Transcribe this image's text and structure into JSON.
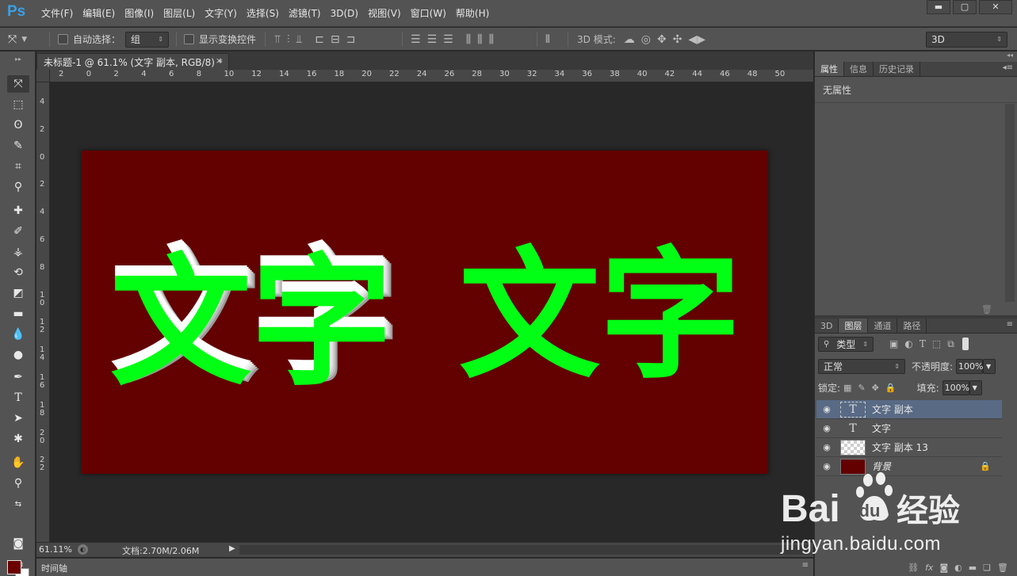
{
  "app": {
    "logo": "Ps",
    "menu": [
      "文件(F)",
      "编辑(E)",
      "图像(I)",
      "图层(L)",
      "文字(Y)",
      "选择(S)",
      "滤镜(T)",
      "3D(D)",
      "视图(V)",
      "窗口(W)",
      "帮助(H)"
    ],
    "window_controls": [
      "▬",
      "▢",
      "✕"
    ]
  },
  "options_bar": {
    "auto_select_label": "自动选择：",
    "auto_select_value": "组",
    "show_transform_label": "显示变换控件",
    "mode_label": "3D 模式:",
    "workspace_value": "3D"
  },
  "document": {
    "tab_title": "未标题-1 @ 61.1% (文字 副本, RGB/8) *",
    "tab_close": "×",
    "ruler_h": [
      "2",
      "0",
      "2",
      "4",
      "6",
      "8",
      "10",
      "12",
      "14",
      "16",
      "18",
      "20",
      "22",
      "24",
      "26",
      "28",
      "30",
      "32",
      "34",
      "36",
      "38",
      "40",
      "42",
      "44",
      "46",
      "48",
      "50"
    ],
    "ruler_v": [
      "4",
      "2",
      "0",
      "2",
      "4",
      "6",
      "8",
      "10",
      "12",
      "14",
      "16",
      "18",
      "20",
      "22"
    ],
    "canvas_color": "#630000",
    "text_left": "文字",
    "text_right": "文字",
    "text_color": "#00ff14"
  },
  "status": {
    "zoom": "61.11%",
    "doc_info": "文档:2.70M/2.06M",
    "timeline_label": "时间轴"
  },
  "properties_panel": {
    "tabs": [
      "属性",
      "信息",
      "历史记录"
    ],
    "content": "无属性"
  },
  "layers_panel": {
    "tabs": [
      "3D",
      "图层",
      "通道",
      "路径"
    ],
    "filter_label": "类型",
    "blend_mode": "正常",
    "opacity_label": "不透明度:",
    "opacity_value": "100%",
    "lock_label": "锁定:",
    "fill_label": "填充:",
    "fill_value": "100%",
    "layers": [
      {
        "name": "文字 副本",
        "type": "text",
        "selected": true
      },
      {
        "name": "文字",
        "type": "text",
        "selected": false
      },
      {
        "name": "文字 副本 13",
        "type": "raster",
        "selected": false
      },
      {
        "name": "背景",
        "type": "background",
        "selected": false
      }
    ]
  },
  "watermark": {
    "brand_left": "Bai",
    "brand_right": "经验",
    "url": "jingyan.baidu.com"
  }
}
